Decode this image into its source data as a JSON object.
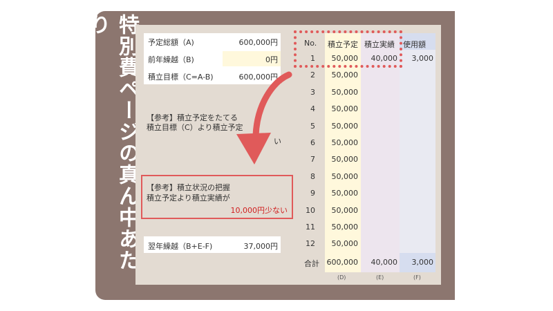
{
  "side_title": "特別費ページの真ん中あたり",
  "summary": [
    {
      "label": "予定総額（A)",
      "value": "600,000円"
    },
    {
      "label": "前年繰越（B)",
      "value": "0円"
    },
    {
      "label": "積立目標（C=A-B)",
      "value": "600,000円"
    }
  ],
  "note1": {
    "line1": "【参考】積立予定をたてる",
    "line2": "積立目標（C）より積立予定",
    "tail": "い"
  },
  "note2": {
    "line1": "【参考】積立状況の把握",
    "line2": "積立予定より積立実績が",
    "line3": "10,000円少ない"
  },
  "carry": {
    "label": "翌年繰越（B+E-F)",
    "value": "37,000円"
  },
  "table": {
    "headers": [
      "No.",
      "積立予定",
      "積立実績",
      "使用額"
    ],
    "rows": [
      [
        "1",
        "50,000",
        "40,000",
        "3,000"
      ],
      [
        "2",
        "50,000",
        "",
        ""
      ],
      [
        "3",
        "50,000",
        "",
        ""
      ],
      [
        "4",
        "50,000",
        "",
        ""
      ],
      [
        "5",
        "50,000",
        "",
        ""
      ],
      [
        "6",
        "50,000",
        "",
        ""
      ],
      [
        "7",
        "50,000",
        "",
        ""
      ],
      [
        "8",
        "50,000",
        "",
        ""
      ],
      [
        "9",
        "50,000",
        "",
        ""
      ],
      [
        "10",
        "50,000",
        "",
        ""
      ],
      [
        "11",
        "50,000",
        "",
        ""
      ],
      [
        "12",
        "50,000",
        "",
        ""
      ]
    ],
    "total": {
      "label": "合計",
      "d": "600,000",
      "e": "40,000",
      "f": "3,000"
    },
    "footers": [
      "(D)",
      "(E)",
      "(F)"
    ]
  },
  "colors": {
    "frame": "#8c766f",
    "sheet": "#e3dbd2",
    "accent_red": "#e05a5a",
    "warning_text": "#d02020",
    "plan_col": "#fff8dc",
    "used_col": "#d6ddef"
  }
}
